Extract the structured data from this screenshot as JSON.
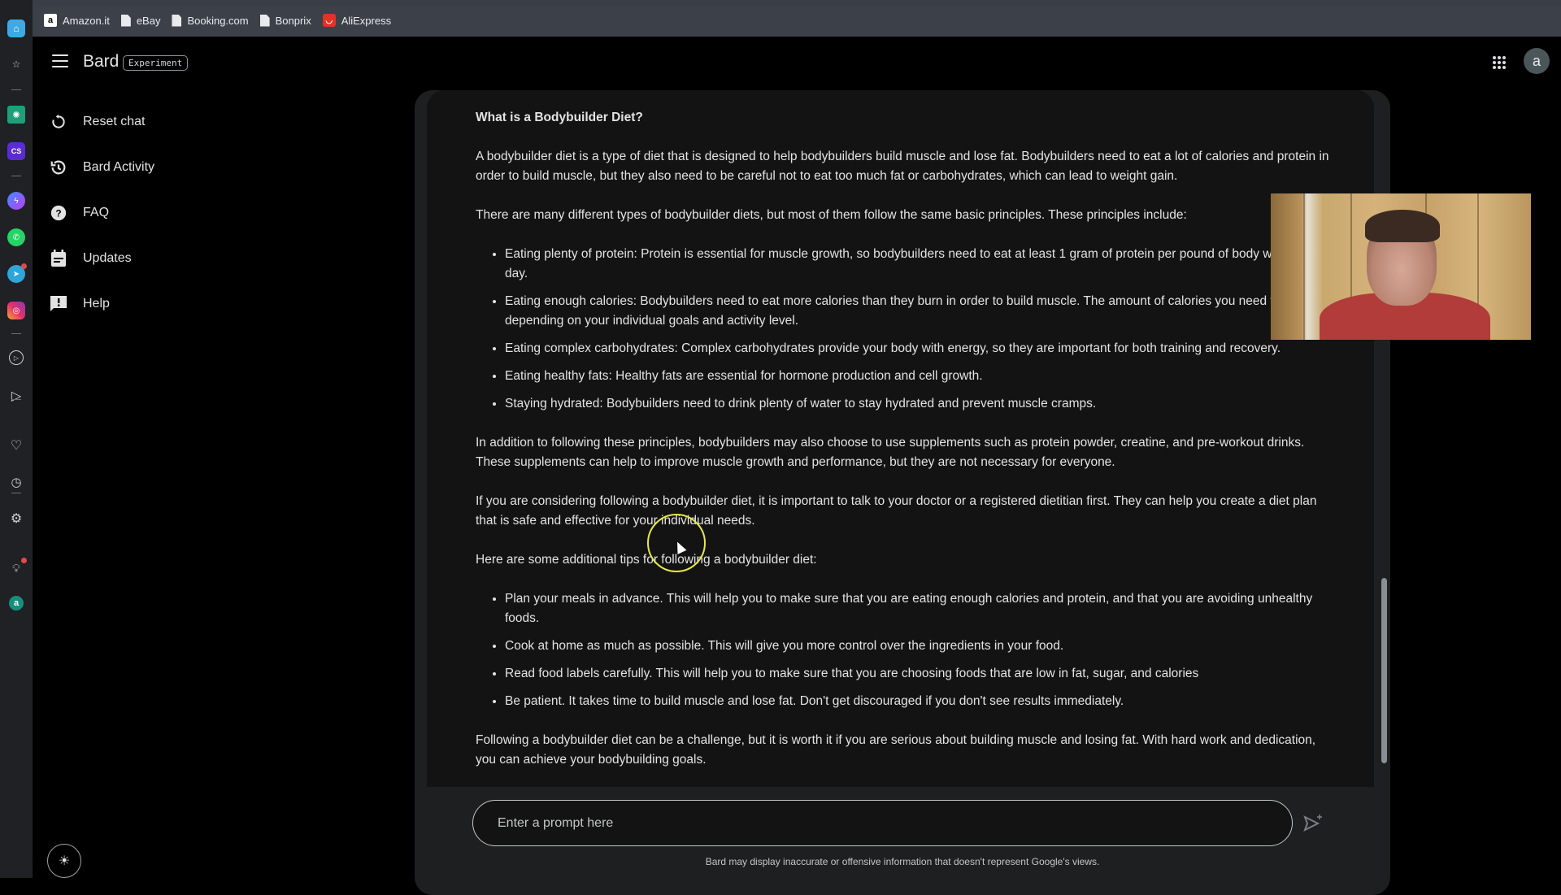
{
  "browser": {
    "bookmarks": [
      {
        "label": "Amazon.it",
        "icon": "amazon-icon"
      },
      {
        "label": "eBay",
        "icon": "page-icon"
      },
      {
        "label": "Booking.com",
        "icon": "page-icon"
      },
      {
        "label": "Bonprix",
        "icon": "page-icon"
      },
      {
        "label": "AliExpress",
        "icon": "aliexpress-icon"
      }
    ]
  },
  "rail": {
    "items": [
      "home-icon",
      "star-icon",
      "chatgpt-icon",
      "cs-app-icon",
      "messenger-icon",
      "whatsapp-icon",
      "telegram-icon",
      "instagram-icon",
      "play-icon",
      "send-icon",
      "heart-icon",
      "clock-icon",
      "gear-icon",
      "lightbulb-icon",
      "a-app-icon"
    ]
  },
  "header": {
    "brand": "Bard",
    "badge": "Experiment",
    "avatar_letter": "a"
  },
  "sidenav": {
    "items": [
      {
        "label": "Reset chat",
        "icon": "reset-icon"
      },
      {
        "label": "Bard Activity",
        "icon": "history-icon"
      },
      {
        "label": "FAQ",
        "icon": "help-circle-icon"
      },
      {
        "label": "Updates",
        "icon": "calendar-icon"
      },
      {
        "label": "Help",
        "icon": "feedback-icon"
      }
    ]
  },
  "response": {
    "heading": "What is a Bodybuilder Diet?",
    "para1": "A bodybuilder diet is a type of diet that is designed to help bodybuilders build muscle and lose fat. Bodybuilders need to eat a lot of calories and protein in order to build muscle, but they also need to be careful not to eat too much fat or carbohydrates, which can lead to weight gain.",
    "para2": "There are many different types of bodybuilder diets, but most of them follow the same basic principles. These principles include:",
    "principles": [
      "Eating plenty of protein: Protein is essential for muscle growth, so bodybuilders need to eat at least 1 gram of protein per pound of body weight each day.",
      "Eating enough calories: Bodybuilders need to eat more calories than they burn in order to build muscle. The amount of calories you need will vary depending on your individual goals and activity level.",
      "Eating complex carbohydrates: Complex carbohydrates provide your body with energy, so they are important for both training and recovery.",
      "Eating healthy fats: Healthy fats are essential for hormone production and cell growth.",
      "Staying hydrated: Bodybuilders need to drink plenty of water to stay hydrated and prevent muscle cramps."
    ],
    "para3": "In addition to following these principles, bodybuilders may also choose to use supplements such as protein powder, creatine, and pre-workout drinks. These supplements can help to improve muscle growth and performance, but they are not necessary for everyone.",
    "para4": "If you are considering following a bodybuilder diet, it is important to talk to your doctor or a registered dietitian first. They can help you create a diet plan that is safe and effective for your individual needs.",
    "para5": "Here are some additional tips for following a bodybuilder diet:",
    "tips": [
      "Plan your meals in advance. This will help you to make sure that you are eating enough calories and protein, and that you are avoiding unhealthy foods.",
      "Cook at home as much as possible. This will give you more control over the ingredients in your food.",
      "Read food labels carefully. This will help you to make sure that you are choosing foods that are low in fat, sugar, and calories",
      "Be patient. It takes time to build muscle and lose fat. Don't get discouraged if you don't see results immediately."
    ],
    "para6": "Following a bodybuilder diet can be a challenge, but it is worth it if you are serious about building muscle and losing fat. With hard work and dedication, you can achieve your bodybuilding goals."
  },
  "prompt": {
    "placeholder": "Enter a prompt here",
    "value": ""
  },
  "disclaimer": "Bard may display inaccurate or offensive information that doesn't represent Google's views."
}
